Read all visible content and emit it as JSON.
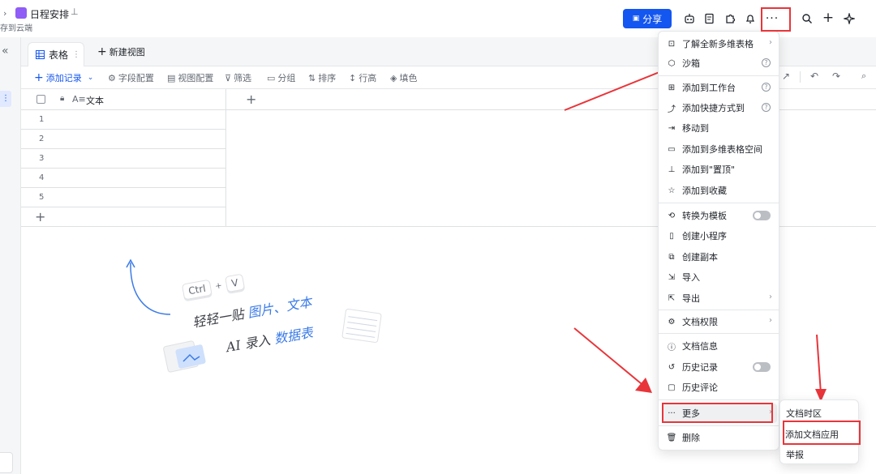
{
  "doc": {
    "title": "日程安排",
    "save_status": "存到云端"
  },
  "header": {
    "share_label": "分享"
  },
  "tabs": {
    "active": "表格",
    "new_view": "新建视图"
  },
  "toolbar": {
    "add_record": "添加记录",
    "items": [
      "字段配置",
      "视图配置",
      "筛选",
      "分组",
      "排序",
      "行高",
      "填色"
    ]
  },
  "grid": {
    "column": "文本",
    "rows": [
      "1",
      "2",
      "3",
      "4",
      "5"
    ]
  },
  "empty_state": {
    "ctrl": "Ctrl",
    "plus": "+",
    "v": "V",
    "line1_prefix": "轻轻一贴 ",
    "line1_highlight": "图片、文本",
    "line2_prefix": "AI 录入 ",
    "line2_highlight": "数据表"
  },
  "menu": {
    "items": [
      "了解全新多维表格",
      "沙箱",
      "添加到工作台",
      "添加快捷方式到",
      "移动到",
      "添加到多维表格空间",
      "添加到\"置顶\"",
      "添加到收藏",
      "转换为模板",
      "创建小程序",
      "创建副本",
      "导入",
      "导出",
      "文档权限",
      "文档信息",
      "历史记录",
      "历史评论",
      "更多",
      "删除"
    ]
  },
  "submenu": {
    "items": [
      "文档时区",
      "添加文档应用",
      "举报"
    ]
  },
  "colors": {
    "accent": "#1456f0",
    "annotation": "#e8353a"
  }
}
